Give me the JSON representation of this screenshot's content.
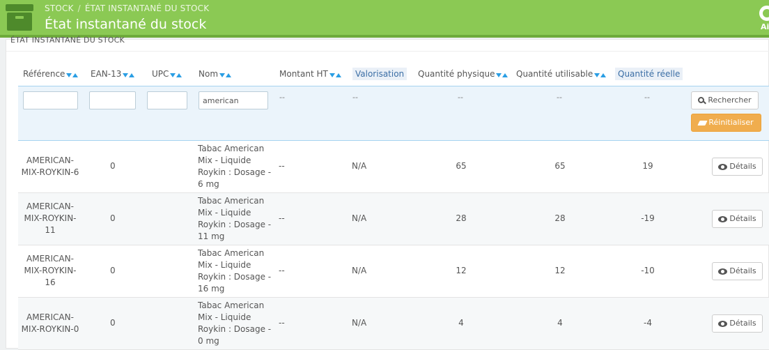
{
  "header": {
    "breadcrumb": [
      "STOCK",
      "ÉTAT INSTANTANÉ DU STOCK"
    ],
    "breadcrumb_separator": "/",
    "title": "État instantané du stock",
    "help_label": "Ai",
    "colors": {
      "bar": "#8bc954",
      "stripe": "#6eab3b",
      "icon": "#4e8a2b"
    }
  },
  "panel": {
    "heading": "ÉTAT INSTANTANÉ DU STOCK"
  },
  "columns": [
    {
      "label": "Référence",
      "sortable": true
    },
    {
      "label": "EAN-13",
      "sortable": true
    },
    {
      "label": "UPC",
      "sortable": true
    },
    {
      "label": "Nom",
      "sortable": true
    },
    {
      "label": "Montant HT",
      "sortable": true
    },
    {
      "label": "Valorisation",
      "sortable": false,
      "highlighted": true
    },
    {
      "label": "Quantité physique",
      "sortable": true
    },
    {
      "label": "Quantité utilisable",
      "sortable": true
    },
    {
      "label": "Quantité réelle",
      "sortable": false,
      "highlighted": true
    }
  ],
  "filters": {
    "reference": "",
    "ean13": "",
    "upc": "",
    "name": "american",
    "placeholder_dash": "--",
    "search_label": "Rechercher",
    "reset_label": "Réinitialiser"
  },
  "rows": [
    {
      "reference": [
        "AMERICAN-",
        "MIX-ROYKIN-6"
      ],
      "ean13": "0",
      "upc": "",
      "name": [
        "Tabac American",
        "Mix - Liquide",
        "Roykin : Dosage -",
        "6 mg"
      ],
      "amount": "--",
      "valuation": "N/A",
      "physical": "65",
      "usable": "65",
      "real": "19",
      "details_label": "Détails"
    },
    {
      "reference": [
        "AMERICAN-",
        "MIX-ROYKIN-",
        "11"
      ],
      "ean13": "0",
      "upc": "",
      "name": [
        "Tabac American",
        "Mix - Liquide",
        "Roykin : Dosage -",
        "11 mg"
      ],
      "amount": "--",
      "valuation": "N/A",
      "physical": "28",
      "usable": "28",
      "real": "-19",
      "details_label": "Détails"
    },
    {
      "reference": [
        "AMERICAN-",
        "MIX-ROYKIN-",
        "16"
      ],
      "ean13": "0",
      "upc": "",
      "name": [
        "Tabac American",
        "Mix - Liquide",
        "Roykin : Dosage -",
        "16 mg"
      ],
      "amount": "--",
      "valuation": "N/A",
      "physical": "12",
      "usable": "12",
      "real": "-10",
      "details_label": "Détails"
    },
    {
      "reference": [
        "AMERICAN-",
        "MIX-ROYKIN-0"
      ],
      "ean13": "0",
      "upc": "",
      "name": [
        "Tabac American",
        "Mix - Liquide",
        "Roykin : Dosage -",
        "0 mg"
      ],
      "amount": "--",
      "valuation": "N/A",
      "physical": "4",
      "usable": "4",
      "real": "-4",
      "details_label": "Détails"
    }
  ]
}
